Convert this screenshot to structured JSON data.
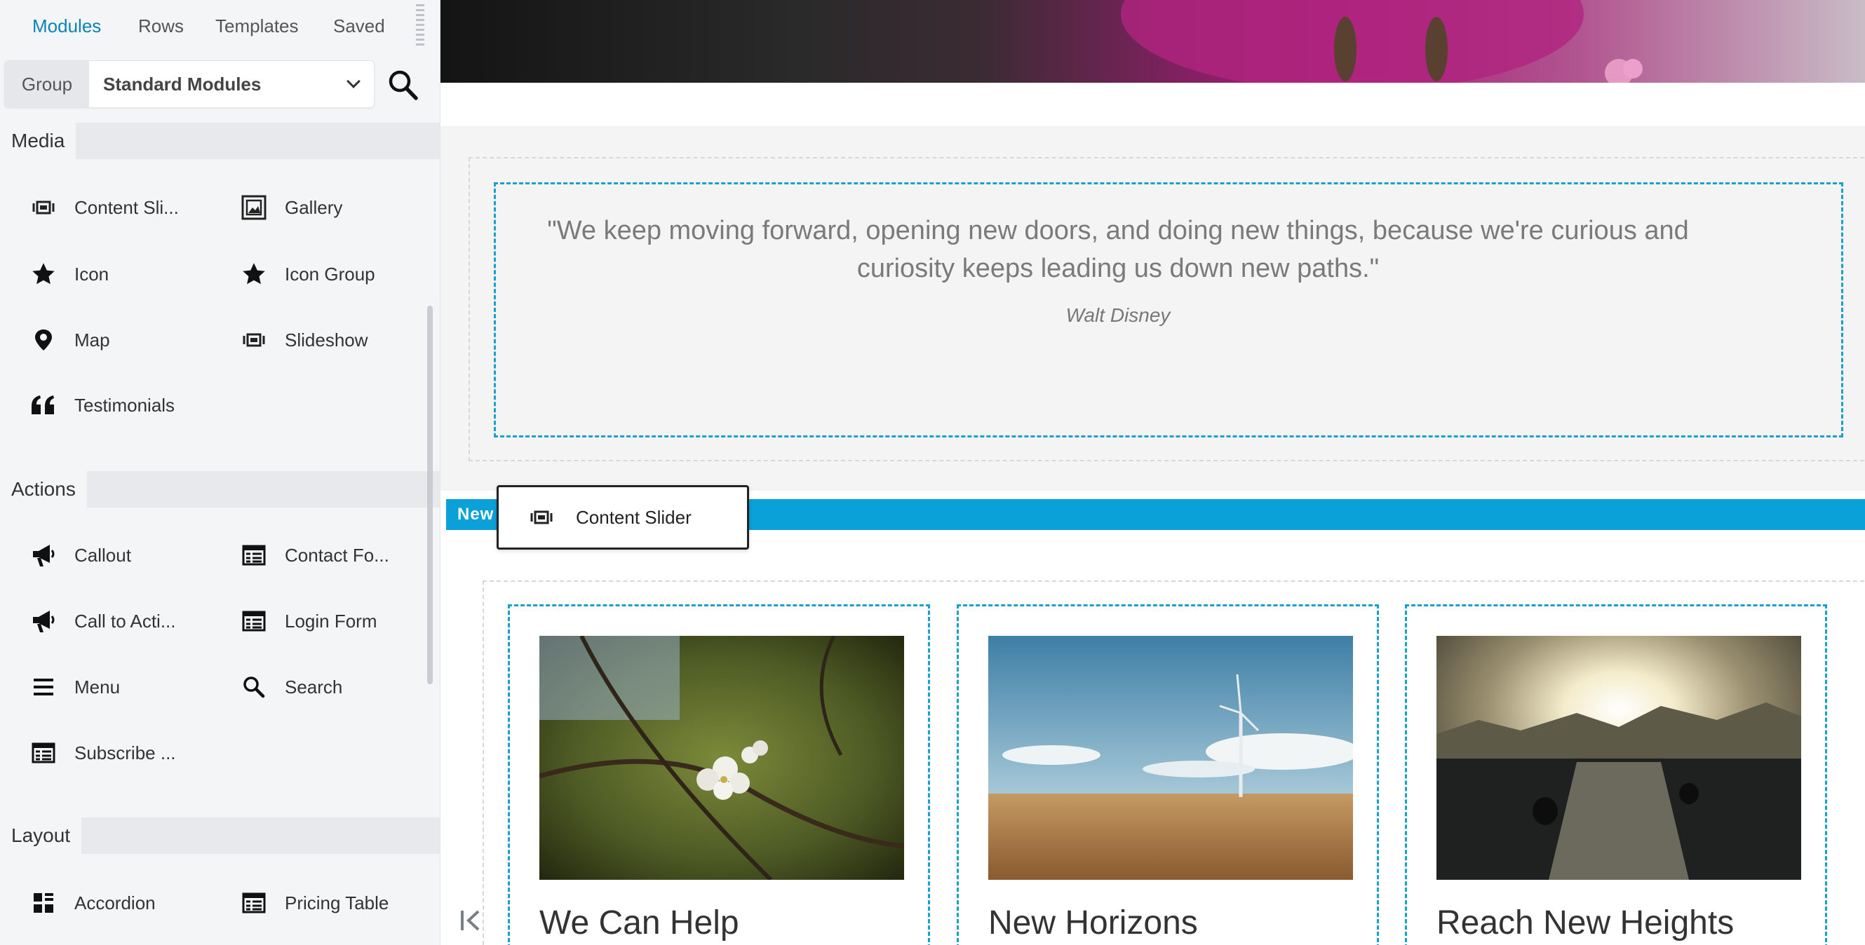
{
  "sidebar": {
    "tabs": [
      {
        "label": "Modules",
        "active": true
      },
      {
        "label": "Rows",
        "active": false
      },
      {
        "label": "Templates",
        "active": false
      },
      {
        "label": "Saved",
        "active": false
      }
    ],
    "group_label": "Group",
    "group_value": "Standard Modules",
    "sections": [
      {
        "title": "Media",
        "items": [
          {
            "label": "Content Sli...",
            "icon": "slider-icon"
          },
          {
            "label": "Gallery",
            "icon": "gallery-icon"
          },
          {
            "label": "Icon",
            "icon": "star-icon"
          },
          {
            "label": "Icon Group",
            "icon": "star-icon"
          },
          {
            "label": "Map",
            "icon": "map-pin-icon"
          },
          {
            "label": "Slideshow",
            "icon": "slider-icon"
          },
          {
            "label": "Testimonials",
            "icon": "quote-icon"
          }
        ]
      },
      {
        "title": "Actions",
        "items": [
          {
            "label": "Callout",
            "icon": "megaphone-icon"
          },
          {
            "label": "Contact Fo...",
            "icon": "form-icon"
          },
          {
            "label": "Call to Acti...",
            "icon": "megaphone-icon"
          },
          {
            "label": "Login Form",
            "icon": "form-icon"
          },
          {
            "label": "Menu",
            "icon": "menu-icon"
          },
          {
            "label": "Search",
            "icon": "search-icon"
          },
          {
            "label": "Subscribe ...",
            "icon": "form-icon"
          }
        ]
      },
      {
        "title": "Layout",
        "items": [
          {
            "label": "Accordion",
            "icon": "accordion-icon"
          },
          {
            "label": "Pricing Table",
            "icon": "form-icon"
          }
        ]
      }
    ]
  },
  "canvas": {
    "quote": "\"We keep moving forward, opening new doors, and doing new things, because we're curious and curiosity keeps leading us down new paths.\"",
    "quote_author": "Walt Disney",
    "drop_bar_label": "New",
    "drag_chip_label": "Content Slider",
    "cards": [
      {
        "title": "We Can Help"
      },
      {
        "title": "New Horizons"
      },
      {
        "title": "Reach New Heights"
      }
    ]
  },
  "colors": {
    "accent": "#0b84b8",
    "drop_bar": "#0aa0d8",
    "dashed_border": "#1aa0cc"
  }
}
